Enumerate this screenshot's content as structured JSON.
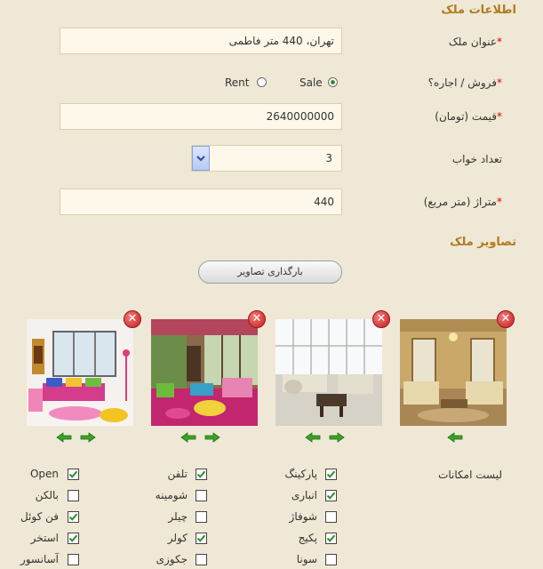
{
  "sections": {
    "property_info": "اطلاعات ملک",
    "property_images": "تصاویر ملک"
  },
  "form": {
    "title": {
      "label": "عنوان ملک",
      "req": "*",
      "value": "تهران، 440 متر فاطمی"
    },
    "sale_type": {
      "label": "فروش / اجاره؟",
      "req": "*",
      "options": [
        "Sale",
        "Rent"
      ],
      "selected": "Sale"
    },
    "price": {
      "label": "قیمت (تومان)",
      "req": "*",
      "value": "2640000000"
    },
    "bedrooms": {
      "label": "تعداد خواب",
      "value": "3"
    },
    "area": {
      "label": "متراژ (متر مربع)",
      "req": "*",
      "value": "440"
    }
  },
  "upload_button": "بارگذاری تصاویر",
  "amenities": {
    "label": "لیست امکانات",
    "items": [
      {
        "label": "پارکینگ",
        "checked": true
      },
      {
        "label": "انباری",
        "checked": true
      },
      {
        "label": "شوفاژ",
        "checked": false
      },
      {
        "label": "پکیج",
        "checked": true
      },
      {
        "label": "سونا",
        "checked": false
      },
      {
        "label": "تلفن",
        "checked": true
      },
      {
        "label": "شومینه",
        "checked": false
      },
      {
        "label": "چیلر",
        "checked": false
      },
      {
        "label": "کولر",
        "checked": true
      },
      {
        "label": "جکوزی",
        "checked": false
      },
      {
        "label": "Open",
        "checked": true
      },
      {
        "label": "بالکن",
        "checked": false
      },
      {
        "label": "فن کوئل",
        "checked": true
      },
      {
        "label": "استخر",
        "checked": true
      },
      {
        "label": "آسانسور",
        "checked": false
      }
    ]
  },
  "colors": {
    "background": "#efe8d6",
    "section_title": "#b07a1e",
    "required": "#dd0000",
    "field_bg": "#fdf8e9",
    "arrow_green": "#2f9a1c"
  }
}
